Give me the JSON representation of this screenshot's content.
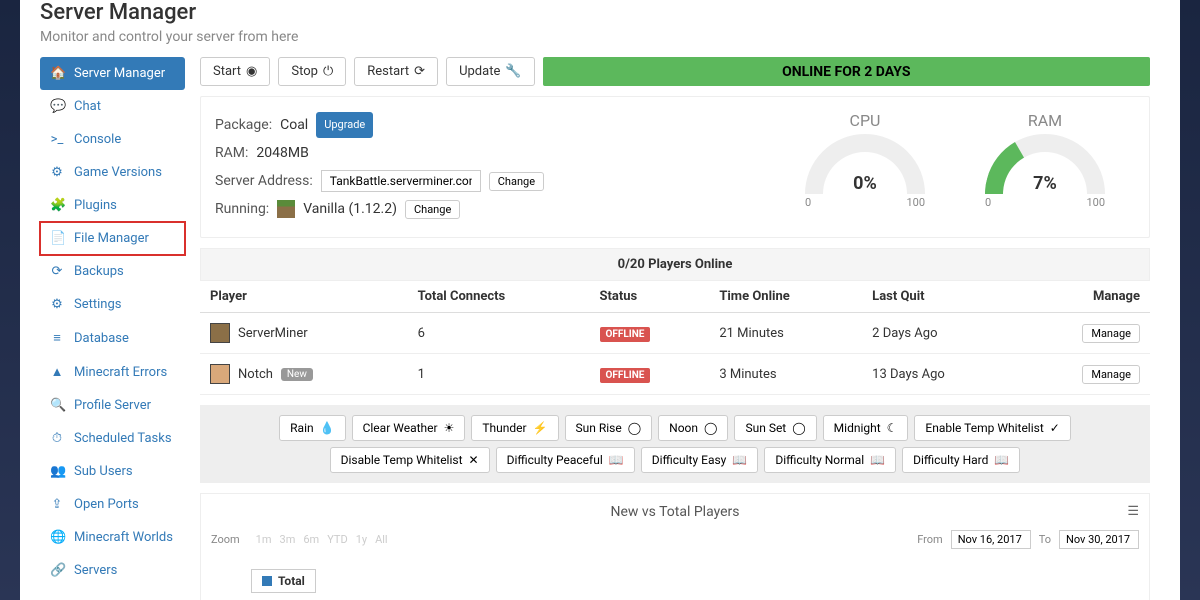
{
  "header": {
    "title": "Server Manager",
    "subtitle": "Monitor and control your server from here"
  },
  "sidebar": {
    "items": [
      {
        "icon": "🏠",
        "label": "Server Manager",
        "active": true
      },
      {
        "icon": "💬",
        "label": "Chat"
      },
      {
        "icon": ">_",
        "label": "Console"
      },
      {
        "icon": "⚙",
        "label": "Game Versions"
      },
      {
        "icon": "🧩",
        "label": "Plugins"
      },
      {
        "icon": "📄",
        "label": "File Manager",
        "highlighted": true
      },
      {
        "icon": "⟳",
        "label": "Backups"
      },
      {
        "icon": "⚙",
        "label": "Settings"
      },
      {
        "icon": "≡",
        "label": "Database"
      },
      {
        "icon": "▲",
        "label": "Minecraft Errors"
      },
      {
        "icon": "🔍",
        "label": "Profile Server"
      },
      {
        "icon": "⏱",
        "label": "Scheduled Tasks"
      },
      {
        "icon": "👥",
        "label": "Sub Users"
      },
      {
        "icon": "⇪",
        "label": "Open Ports"
      },
      {
        "icon": "🌐",
        "label": "Minecraft Worlds"
      },
      {
        "icon": "🔗",
        "label": "Servers"
      }
    ]
  },
  "controls": {
    "start": "Start",
    "stop": "Stop",
    "restart": "Restart",
    "update": "Update"
  },
  "status_bar": "ONLINE FOR 2 DAYS",
  "info": {
    "package_label": "Package:",
    "package_value": "Coal",
    "upgrade": "Upgrade",
    "ram_label": "RAM:",
    "ram_value": "2048MB",
    "addr_label": "Server Address:",
    "addr_value": "TankBattle.serverminer.com",
    "change": "Change",
    "running_label": "Running:",
    "running_value": "Vanilla (1.12.2)"
  },
  "gauges": {
    "cpu": {
      "title": "CPU",
      "value": "0%",
      "min": "0",
      "max": "100"
    },
    "ram": {
      "title": "RAM",
      "value": "7%",
      "min": "0",
      "max": "100"
    }
  },
  "players_header": "0/20 Players Online",
  "players_columns": {
    "player": "Player",
    "connects": "Total Connects",
    "status": "Status",
    "time": "Time Online",
    "quit": "Last Quit",
    "manage": "Manage"
  },
  "players": [
    {
      "name": "ServerMiner",
      "connects": "6",
      "status": "OFFLINE",
      "time": "21 Minutes",
      "quit": "2 Days Ago",
      "new": false
    },
    {
      "name": "Notch",
      "connects": "1",
      "status": "OFFLINE",
      "time": "3 Minutes",
      "quit": "13 Days Ago",
      "new": true
    }
  ],
  "manage_btn": "Manage",
  "new_label": "New",
  "actions": [
    {
      "label": "Rain",
      "icon": "💧"
    },
    {
      "label": "Clear Weather",
      "icon": "☀"
    },
    {
      "label": "Thunder",
      "icon": "⚡"
    },
    {
      "label": "Sun Rise",
      "icon": "◯"
    },
    {
      "label": "Noon",
      "icon": "◯"
    },
    {
      "label": "Sun Set",
      "icon": "◯"
    },
    {
      "label": "Midnight",
      "icon": "☾"
    },
    {
      "label": "Enable Temp Whitelist",
      "icon": "✓"
    },
    {
      "label": "Disable Temp Whitelist",
      "icon": "✕"
    },
    {
      "label": "Difficulty Peaceful",
      "icon": "📖"
    },
    {
      "label": "Difficulty Easy",
      "icon": "📖"
    },
    {
      "label": "Difficulty Normal",
      "icon": "📖"
    },
    {
      "label": "Difficulty Hard",
      "icon": "📖"
    }
  ],
  "chart": {
    "title": "New vs Total Players",
    "zoom_label": "Zoom",
    "zoom_opts": [
      "1m",
      "3m",
      "6m",
      "YTD",
      "1y",
      "All"
    ],
    "from_label": "From",
    "from_value": "Nov 16, 2017",
    "to_label": "To",
    "to_value": "Nov 30, 2017",
    "legend": "Total"
  }
}
